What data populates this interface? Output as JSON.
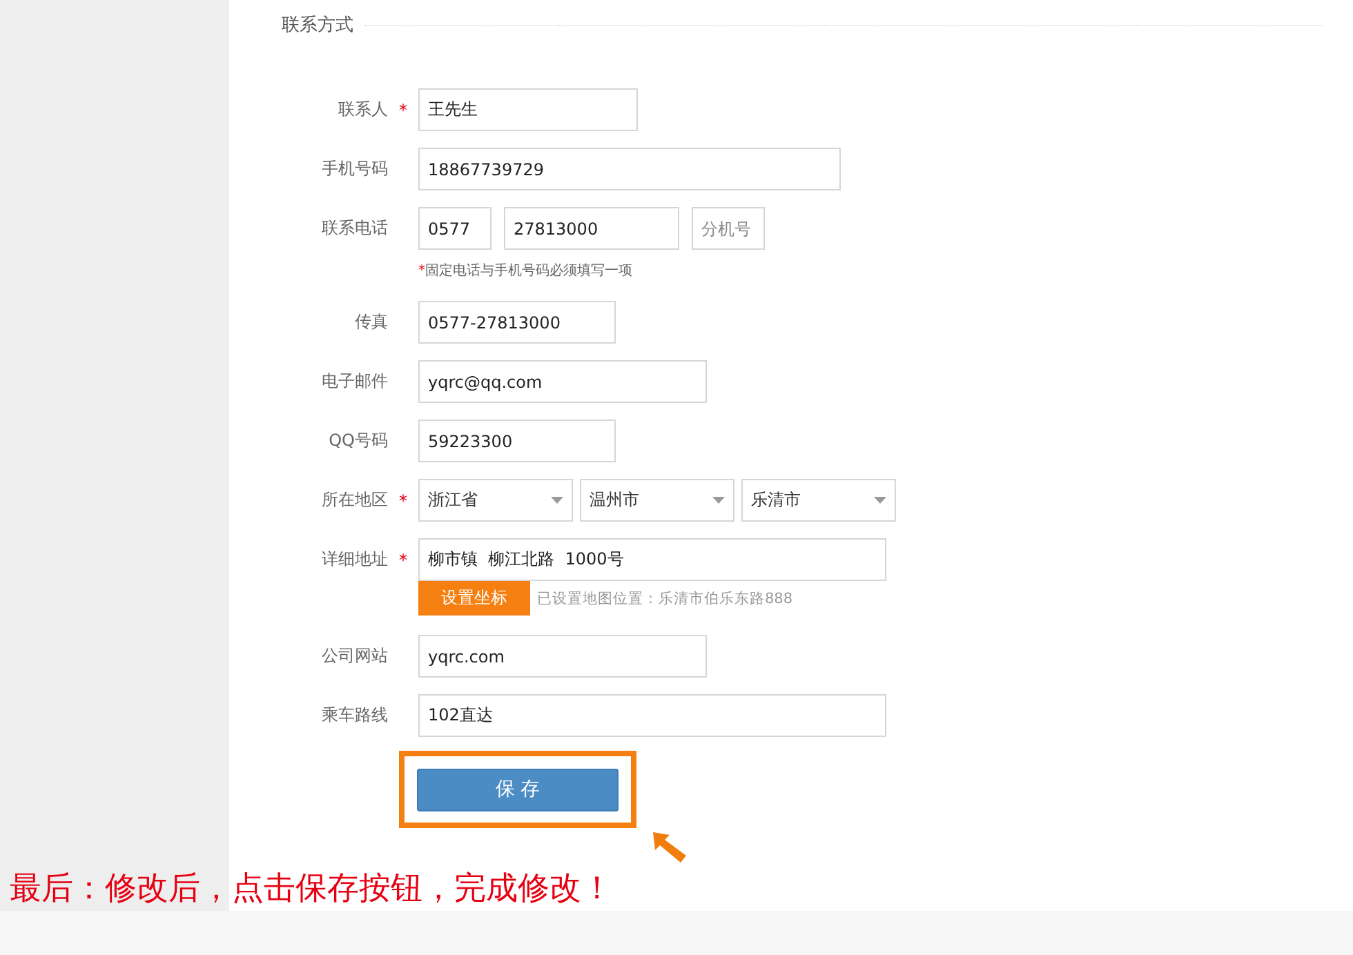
{
  "section_title": "联系方式",
  "rows": [
    {
      "label": "联系人",
      "required": true,
      "fields": [
        {
          "kind": "input",
          "value": "王先生"
        }
      ]
    },
    {
      "label": "手机号码",
      "required": false,
      "fields": [
        {
          "kind": "input",
          "value": "18867739729"
        }
      ]
    },
    {
      "label": "联系电话",
      "required": false,
      "fields": [
        {
          "kind": "input",
          "value": "0577"
        },
        {
          "kind": "input",
          "value": "27813000"
        },
        {
          "kind": "input",
          "placeholder": "分机号"
        }
      ],
      "note": "固定电话与手机号码必须填写一项"
    },
    {
      "label": "传真",
      "required": false,
      "fields": [
        {
          "kind": "input",
          "value": "0577-27813000"
        }
      ]
    },
    {
      "label": "电子邮件",
      "required": false,
      "fields": [
        {
          "kind": "input",
          "value": "yqrc@qq.com"
        }
      ]
    },
    {
      "label": "QQ号码",
      "required": false,
      "fields": [
        {
          "kind": "input",
          "value": "59223300"
        }
      ]
    },
    {
      "label": "所在地区",
      "required": true,
      "fields": [
        {
          "kind": "select",
          "value": "浙江省"
        },
        {
          "kind": "select",
          "value": "温州市"
        },
        {
          "kind": "select",
          "value": "乐清市"
        }
      ]
    },
    {
      "label": "详细地址",
      "required": true,
      "fields": [
        {
          "kind": "input",
          "value": "柳市镇  柳江北路  1000号"
        }
      ],
      "action": {
        "label": "设置坐标",
        "status": "已设置地图位置：乐清市伯乐东路888"
      }
    },
    {
      "label": "公司网站",
      "required": false,
      "fields": [
        {
          "kind": "input",
          "value": "yqrc.com"
        }
      ]
    },
    {
      "label": "乘车路线",
      "required": false,
      "fields": [
        {
          "kind": "input",
          "value": "102直达"
        }
      ]
    }
  ],
  "note_mark": "*",
  "required_mark": "*",
  "save_button": "保 存",
  "caption": "最后：修改后，点击保存按钮，完成修改！"
}
